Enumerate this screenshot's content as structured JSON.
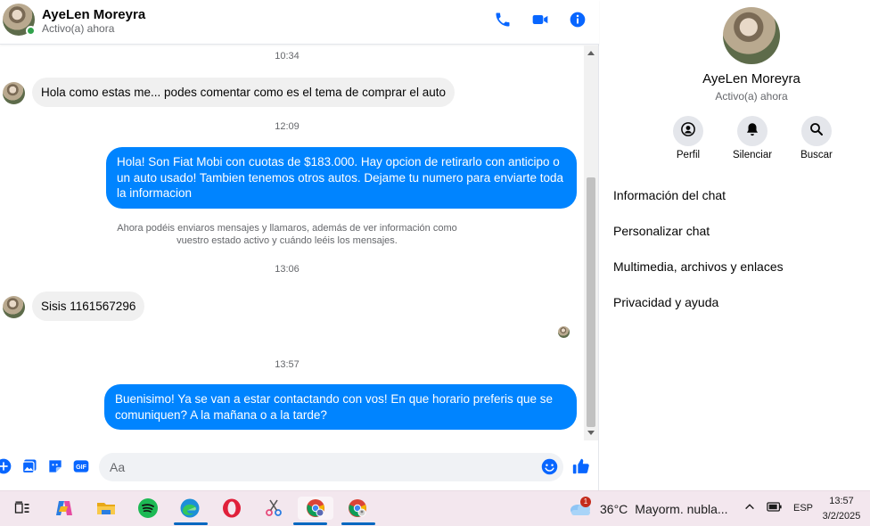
{
  "header": {
    "contact_name": "AyeLen Moreyra",
    "status": "Activo(a) ahora",
    "icons": [
      "phone-icon",
      "video-camera-icon",
      "info-icon"
    ]
  },
  "messages": {
    "ts1": "10:34",
    "msg1": "Hola como estas me... podes comentar como es el tema de comprar el auto",
    "ts2": "12:09",
    "msg2_l1": "Hola! Son Fiat Mobi con cuotas de $183.000. Hay opcion de retirarlo con anticipo o",
    "msg2_l2": "un auto usado! Tambien tenemos otros autos. Dejame tu numero para enviarte toda",
    "msg2_l3": "la informacion",
    "system_l1": "Ahora podéis enviaros mensajes y llamaros, además de ver información como",
    "system_l2": "vuestro estado activo y cuándo leéis los mensajes.",
    "ts3": "13:06",
    "msg3": "Sisis 1161567296",
    "ts4": "13:57",
    "msg4_l1": "Buenisimo! Ya se van a estar contactando con vos! En que horario preferis que se",
    "msg4_l2": "comuniquen? A la mañana o a la tarde?"
  },
  "composer": {
    "placeholder": "Aa",
    "icons": [
      "plus-icon",
      "gallery-icon",
      "sticker-icon",
      "gif-icon",
      "emoji-icon",
      "like-icon"
    ],
    "gif_label": "GIF"
  },
  "sidebar": {
    "name": "AyeLen Moreyra",
    "status": "Activo(a) ahora",
    "actions": [
      {
        "label": "Perfil",
        "icon": "profile-icon"
      },
      {
        "label": "Silenciar",
        "icon": "bell-icon"
      },
      {
        "label": "Buscar",
        "icon": "search-icon"
      }
    ],
    "menu": [
      {
        "label": "Información del chat"
      },
      {
        "label": "Personalizar chat"
      },
      {
        "label": "Multimedia, archivos y enlaces"
      },
      {
        "label": "Privacidad y ayuda"
      }
    ]
  },
  "taskbar": {
    "weather_temp": "36°C",
    "weather_desc": "Mayorm. nubla...",
    "weather_badge": "1",
    "language": "ESP",
    "time": "13:57",
    "date": "3/2/2025"
  },
  "colors": {
    "accent": "#0084ff",
    "icon_blue": "#0866ff",
    "incoming_bubble": "#f0f0f0",
    "online": "#31a24c"
  }
}
